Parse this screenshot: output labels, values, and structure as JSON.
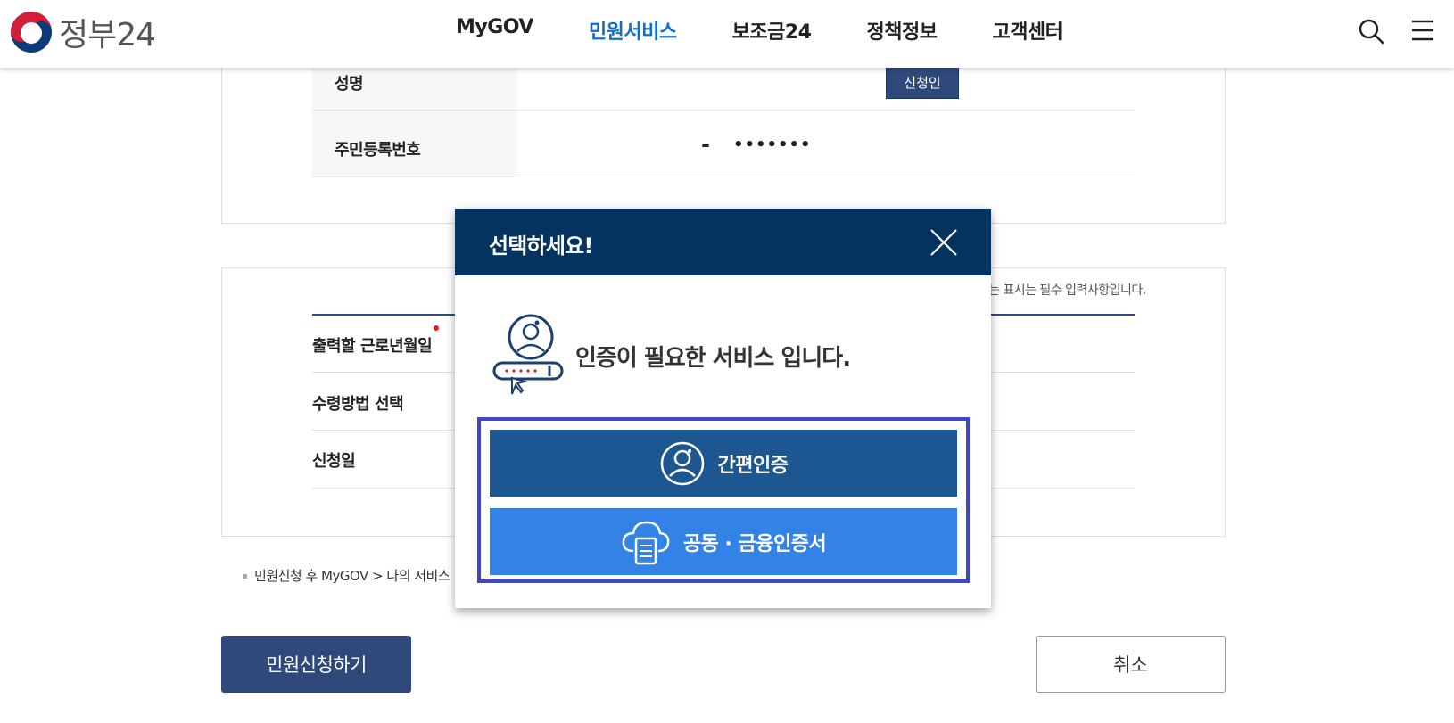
{
  "header": {
    "logo_text": "정부24",
    "nav": [
      "MyGOV",
      "민원서비스",
      "보조금24",
      "정책정보",
      "고객센터"
    ],
    "active_nav": "민원서비스"
  },
  "applicant": {
    "name_label": "성명",
    "applicant_badge": "신청인",
    "rrn_label": "주민등록번호",
    "rrn_dash": "-",
    "rrn_masked": "•••••••"
  },
  "form": {
    "required_note": "는 표시는 필수 입력사항입니다.",
    "work_month_label": "출력할 근로년월일",
    "receive_method_label": "수령방법 선택",
    "apply_date_label": "신청일"
  },
  "notice": "민원신청 후 MyGOV > 나의 서비스",
  "buttons": {
    "submit": "민원신청하기",
    "cancel": "취소"
  },
  "modal": {
    "title": "선택하세요!",
    "message": "인증이 필요한 서비스 입니다.",
    "option_simple": "간편인증",
    "option_cert": "공동 · 금융인증서"
  },
  "colors": {
    "modal_header": "#03335e",
    "simple_auth": "#1d5791",
    "cert_auth": "#3383e6",
    "highlight_frame": "#3f46c8",
    "primary_button": "#2f4a7a",
    "active_nav": "#0f6fd1"
  }
}
